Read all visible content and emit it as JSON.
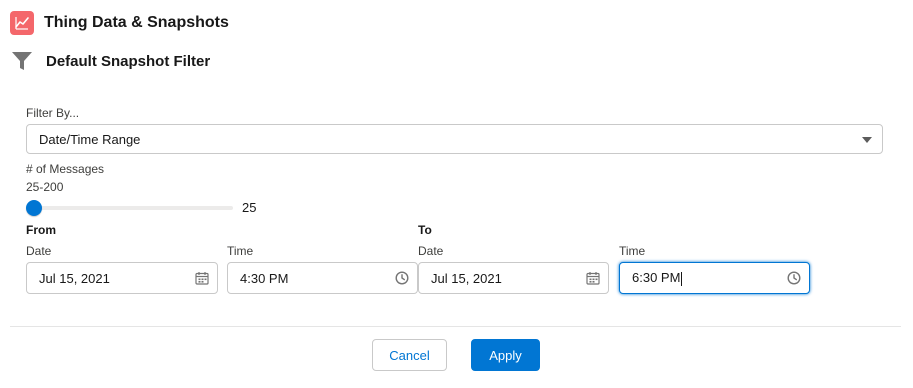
{
  "header": {
    "title": "Thing Data & Snapshots",
    "icon": "line-chart-icon",
    "icon_color": "#f4676b"
  },
  "filter_panel": {
    "title": "Default Snapshot Filter",
    "icon": "funnel-icon"
  },
  "filter_by": {
    "label": "Filter By...",
    "value": "Date/Time Range"
  },
  "messages": {
    "label": "# of Messages",
    "range_text": "25-200",
    "value": "25",
    "min": 25,
    "max": 200,
    "fraction": 0.0
  },
  "from": {
    "heading": "From",
    "date_label": "Date",
    "date_value": "Jul 15, 2021",
    "time_label": "Time",
    "time_value": "4:30 PM"
  },
  "to": {
    "heading": "To",
    "date_label": "Date",
    "date_value": "Jul 15, 2021",
    "time_label": "Time",
    "time_value": "6:30 PM"
  },
  "actions": {
    "cancel_label": "Cancel",
    "apply_label": "Apply"
  },
  "colors": {
    "accent": "#0176d3",
    "border": "#c9c9c9"
  }
}
